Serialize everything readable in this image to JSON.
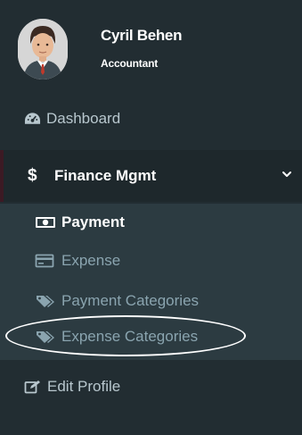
{
  "user": {
    "name": "Cyril Behen",
    "role": "Accountant"
  },
  "menu": {
    "dashboard": {
      "label": "Dashboard",
      "icon": "dashboard-icon"
    },
    "finance": {
      "label": "Finance Mgmt",
      "icon": "dollar-icon",
      "expanded": true
    },
    "finance_items": [
      {
        "label": "Payment",
        "icon": "money-icon",
        "active": true
      },
      {
        "label": "Expense",
        "icon": "credit-card-icon"
      },
      {
        "label": "Payment Categories",
        "icon": "tags-icon"
      },
      {
        "label": "Expense Categories",
        "icon": "tags-icon",
        "circled": true
      }
    ],
    "edit_profile": {
      "label": "Edit Profile",
      "icon": "edit-icon"
    }
  },
  "colors": {
    "sidebar_bg": "#222d32",
    "submenu_bg": "#2c3b41",
    "active_bg": "#1e282c",
    "text_muted": "#8aa4af",
    "text_light": "#b8c7ce"
  }
}
